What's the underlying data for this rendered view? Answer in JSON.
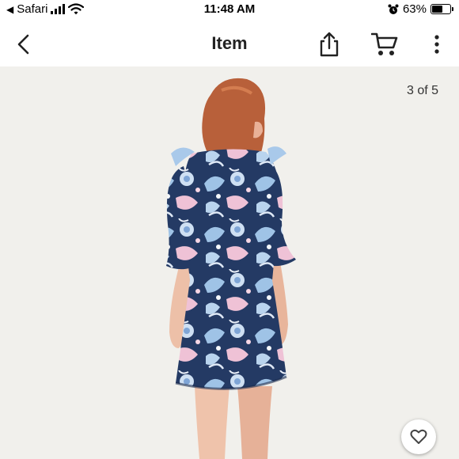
{
  "status_bar": {
    "carrier": "Safari",
    "time": "11:48 AM",
    "battery_percent": "63%",
    "battery_level": 0.63,
    "icons": [
      "back-arrow-icon",
      "signal-icon",
      "wifi-icon",
      "alarm-icon",
      "battery-icon"
    ]
  },
  "navbar": {
    "title": "Item",
    "icons": [
      "chevron-left-icon",
      "share-icon",
      "cart-icon",
      "more-vertical-icon"
    ]
  },
  "gallery": {
    "counter": "3 of 5",
    "image": "woman-in-floral-bell-sleeve-dress-back-view"
  },
  "actions": {
    "like_icon": "heart-icon"
  },
  "colors": {
    "background": "#f1f0ec",
    "dress_navy": "#243a64",
    "dress_blue": "#9fc3e6",
    "dress_pink": "#efc2d6",
    "hair": "#b8603a"
  }
}
